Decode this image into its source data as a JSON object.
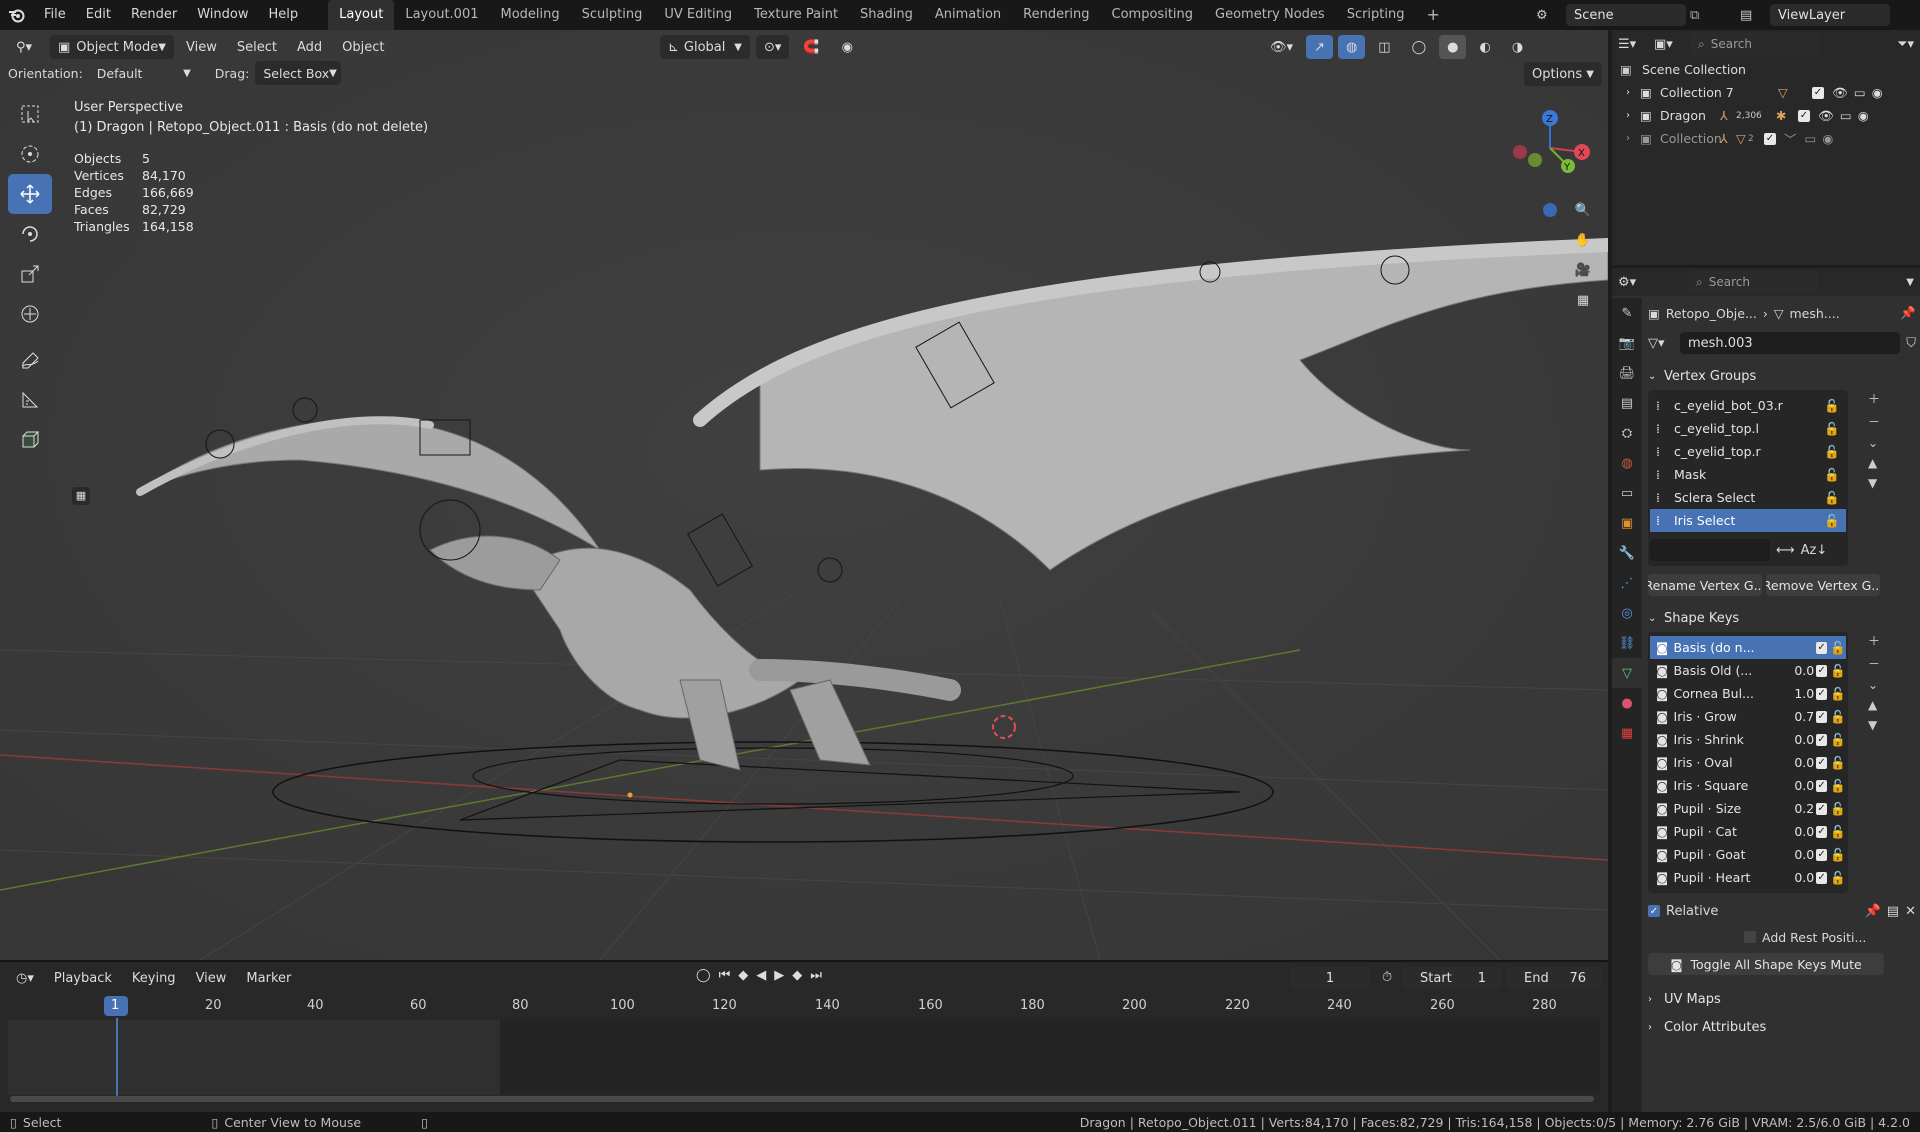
{
  "menu": {
    "items": [
      "File",
      "Edit",
      "Render",
      "Window",
      "Help"
    ],
    "workspaces": [
      "Layout",
      "Layout.001",
      "Modeling",
      "Sculpting",
      "UV Editing",
      "Texture Paint",
      "Shading",
      "Animation",
      "Rendering",
      "Compositing",
      "Geometry Nodes",
      "Scripting"
    ],
    "add_tab": "+",
    "scene": "Scene",
    "view_layer": "ViewLayer"
  },
  "viewport_header": {
    "mode": "Object Mode",
    "menus": [
      "View",
      "Select",
      "Add",
      "Object"
    ],
    "transform": "Global",
    "orientation_label": "Orientation:",
    "orientation_value": "Default",
    "drag_label": "Drag:",
    "drag_value": "Select Box",
    "options": "Options"
  },
  "overlay": {
    "view_name": "User Perspective",
    "object_path": "(1) Dragon | Retopo_Object.011 : Basis (do not delete)",
    "stats": [
      {
        "label": "Objects",
        "value": "5"
      },
      {
        "label": "Vertices",
        "value": "84,170"
      },
      {
        "label": "Edges",
        "value": "166,669"
      },
      {
        "label": "Faces",
        "value": "82,729"
      },
      {
        "label": "Triangles",
        "value": "164,158"
      }
    ],
    "gizmo": {
      "z": "Z",
      "x": "X",
      "y": "Y"
    }
  },
  "timeline": {
    "menus": [
      "Playback",
      "Keying",
      "View",
      "Marker"
    ],
    "current_frame": "1",
    "start_label": "Start",
    "start": "1",
    "end_label": "End",
    "end": "76",
    "ruler": [
      "1",
      "20",
      "40",
      "60",
      "80",
      "100",
      "120",
      "140",
      "160",
      "180",
      "200",
      "220",
      "240",
      "260",
      "280"
    ]
  },
  "outliner": {
    "search_placeholder": "Search",
    "root": "Scene Collection",
    "items": [
      {
        "name": "Collection 7"
      },
      {
        "name": "Dragon",
        "badge": "2,306"
      },
      {
        "name": "Collection",
        "badge": "2"
      }
    ]
  },
  "properties": {
    "search_placeholder": "Search",
    "breadcrumb_object": "Retopo_Obje...",
    "breadcrumb_mesh": "mesh....",
    "mesh_name": "mesh.003",
    "vertex_groups_title": "Vertex Groups",
    "vertex_groups": [
      "c_eyelid_bot_03.r",
      "c_eyelid_top.l",
      "c_eyelid_top.r",
      "Mask",
      "Sclera Select",
      "Iris Select"
    ],
    "selected_group": 5,
    "rename_button": "Rename Vertex G...",
    "remove_button": "Remove Vertex G...",
    "shape_keys_title": "Shape Keys",
    "shape_keys": [
      {
        "name": "Basis (do n...",
        "value": ""
      },
      {
        "name": "Basis Old (...",
        "value": "0.0"
      },
      {
        "name": "Cornea Bul...",
        "value": "1.0"
      },
      {
        "name": "Iris · Grow",
        "value": "0.7"
      },
      {
        "name": "Iris · Shrink",
        "value": "0.0"
      },
      {
        "name": "Iris · Oval",
        "value": "0.0"
      },
      {
        "name": "Iris · Square",
        "value": "0.0"
      },
      {
        "name": "Pupil · Size",
        "value": "0.2"
      },
      {
        "name": "Pupil · Cat",
        "value": "0.0"
      },
      {
        "name": "Pupil · Goat",
        "value": "0.0"
      },
      {
        "name": "Pupil · Heart",
        "value": "0.0"
      }
    ],
    "relative_label": "Relative",
    "add_rest_label": "Add Rest Positi...",
    "toggle_mute": "Toggle All Shape Keys Mute",
    "uv_maps": "UV Maps",
    "color_attributes": "Color Attributes"
  },
  "statusbar": {
    "select": "Select",
    "center_view": "Center View to Mouse",
    "info": "Dragon | Retopo_Object.011 | Verts:84,170 | Faces:82,729 | Tris:164,158 | Objects:0/5 | Memory: 2.76 GiB | VRAM: 2.5/6.0 GiB | 4.2.0"
  },
  "colors": {
    "accent": "#4772b3",
    "viewport_bg": "#393939",
    "panel_bg": "#303030"
  }
}
